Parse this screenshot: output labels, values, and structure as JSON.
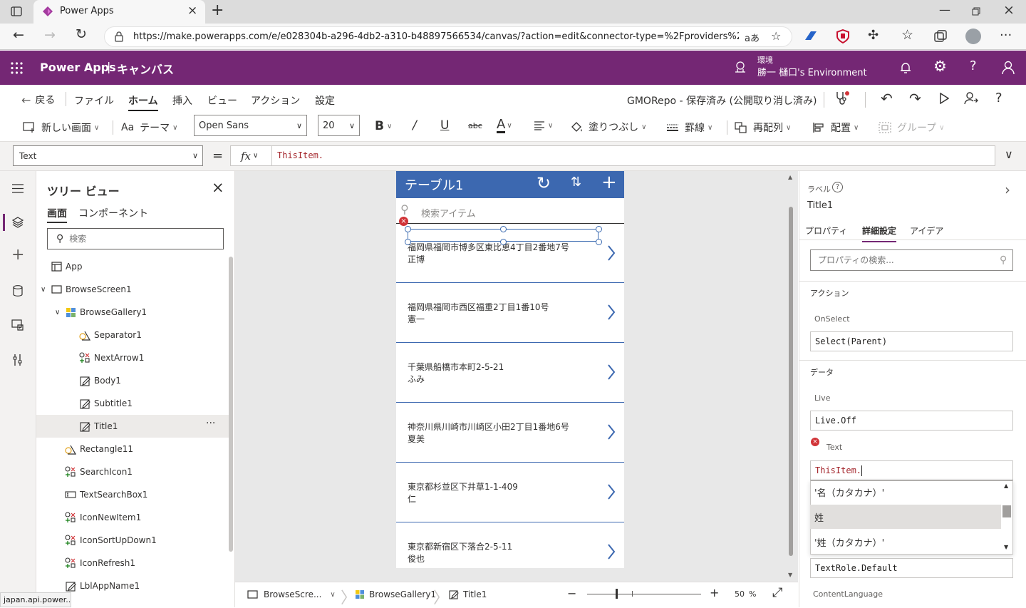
{
  "browser": {
    "tab_title": "Power Apps",
    "url": "https://make.powerapps.com/e/e028304b-a296-4db2-a310-b48897566534/canvas/?action=edit&connector-type=%2Fproviders%2Fm...",
    "status_url": "japan.api.power..."
  },
  "header": {
    "app_name": "Power Apps",
    "separator": "|",
    "mode": "キャンバス",
    "env_label": "環境",
    "env_name": "勝一 樋口's Environment"
  },
  "menu": {
    "back": "戻る",
    "items": [
      "ファイル",
      "ホーム",
      "挿入",
      "ビュー",
      "アクション",
      "設定"
    ],
    "save_status": "GMORepo - 保存済み (公開取り消し済み)"
  },
  "ribbon": {
    "new_screen": "新しい画面",
    "theme": "テーマ",
    "font": "Open Sans",
    "font_size": "20",
    "bold": "B",
    "italic": "/",
    "underline": "U",
    "strike": "abc",
    "font_color": "A",
    "fill": "塗りつぶし",
    "border": "罫線",
    "reorder": "再配列",
    "align": "配置",
    "group": "グループ"
  },
  "formula": {
    "property": "Text",
    "equals": "=",
    "fx": "fx",
    "value": "ThisItem."
  },
  "tree": {
    "title": "ツリー ビュー",
    "tabs": [
      "画面",
      "コンポーネント"
    ],
    "search_placeholder": "検索",
    "items": [
      {
        "label": "App"
      },
      {
        "label": "BrowseScreen1"
      },
      {
        "label": "BrowseGallery1"
      },
      {
        "label": "Separator1"
      },
      {
        "label": "NextArrow1"
      },
      {
        "label": "Body1"
      },
      {
        "label": "Subtitle1"
      },
      {
        "label": "Title1"
      },
      {
        "label": "Rectangle11"
      },
      {
        "label": "SearchIcon1"
      },
      {
        "label": "TextSearchBox1"
      },
      {
        "label": "IconNewItem1"
      },
      {
        "label": "IconSortUpDown1"
      },
      {
        "label": "IconRefresh1"
      },
      {
        "label": "LblAppName1"
      }
    ]
  },
  "canvas": {
    "screen_title": "テーブル1",
    "search_placeholder": "検索アイテム",
    "rows": [
      {
        "line1": "福岡県福岡市博多区東比恵4丁目2番地7号",
        "line2": "正博"
      },
      {
        "line1": "福岡県福岡市西区福重2丁目1番10号",
        "line2": "憲一"
      },
      {
        "line1": "千葉県船橋市本町2-5-21",
        "line2": "ふみ"
      },
      {
        "line1": "神奈川県川崎市川崎区小田2丁目1番地6号",
        "line2": "夏美"
      },
      {
        "line1": "東京都杉並区下井草1-1-409",
        "line2": "仁"
      },
      {
        "line1": "東京都新宿区下落合2-5-11",
        "line2": "俊也"
      }
    ]
  },
  "statusbar": {
    "crumbs": [
      "BrowseScre...",
      "BrowseGallery1",
      "Title1"
    ],
    "zoom_minus": "−",
    "zoom_plus": "+",
    "zoom_value": "50",
    "zoom_unit": "%"
  },
  "props": {
    "type": "ラベル",
    "name": "Title1",
    "tabs": [
      "プロパティ",
      "詳細設定",
      "アイデア"
    ],
    "search_placeholder": "プロパティの検索...",
    "section_action": "アクション",
    "onselect_label": "OnSelect",
    "onselect_value": "Select(Parent)",
    "section_data": "データ",
    "live_label": "Live",
    "live_value": "Live.Off",
    "text_label": "Text",
    "text_value": "ThisItem.",
    "suggestions": [
      "'名（カタカナ）'",
      "姓",
      "'姓（カタカナ）'"
    ],
    "role_value": "TextRole.Default",
    "content_language_label": "ContentLanguage"
  },
  "colors": {
    "brand": "#742774",
    "screen_header": "#3c68b0",
    "error": "#d13438"
  }
}
